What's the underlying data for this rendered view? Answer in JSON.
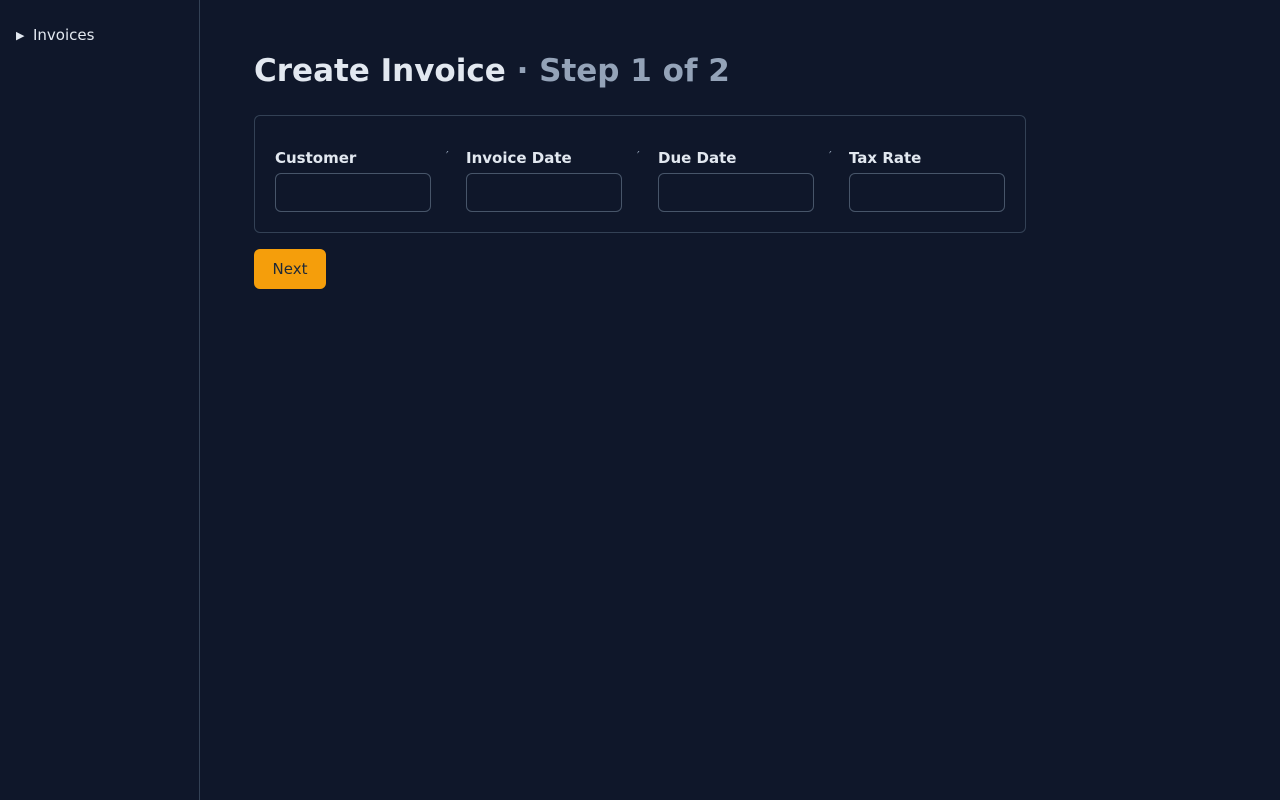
{
  "sidebar": {
    "items": [
      {
        "label": "Invoices",
        "icon": "caret-right-icon",
        "glyph": "▶"
      }
    ]
  },
  "page": {
    "title": "Create Invoice",
    "step": "· Step 1 of 2"
  },
  "form": {
    "separator": "′",
    "fields": [
      {
        "label": "Customer",
        "value": "",
        "placeholder": ""
      },
      {
        "label": "Invoice Date",
        "value": "",
        "placeholder": ""
      },
      {
        "label": "Due Date",
        "value": "",
        "placeholder": ""
      },
      {
        "label": "Tax Rate",
        "value": "",
        "placeholder": ""
      }
    ]
  },
  "actions": {
    "next_label": "Next"
  },
  "colors": {
    "background": "#0f172a",
    "accent": "#f59e0b",
    "border": "#334155",
    "muted_text": "#94a3b8"
  }
}
